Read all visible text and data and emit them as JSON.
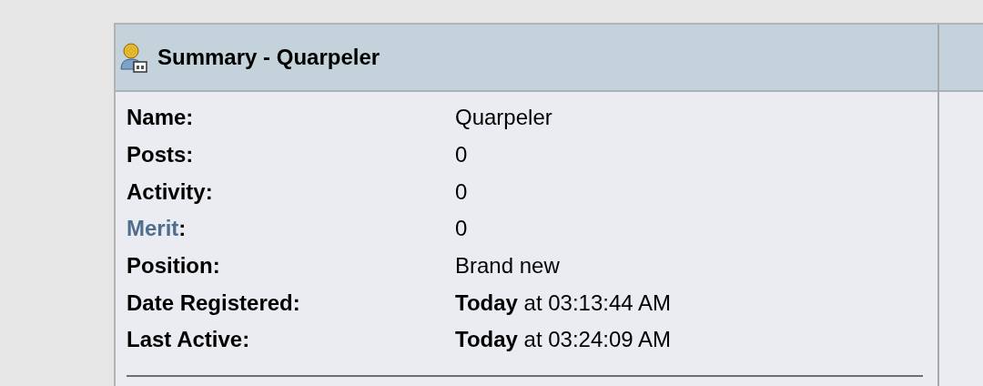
{
  "panel": {
    "title": "Summary - Quarpeler"
  },
  "rows": [
    {
      "kind": "text",
      "label": "Name:",
      "value": "Quarpeler"
    },
    {
      "kind": "text",
      "label": "Posts:",
      "value": "0"
    },
    {
      "kind": "text",
      "label": "Activity:",
      "value": "0"
    },
    {
      "kind": "link",
      "label": "Merit",
      "suffix": ":",
      "value": "0"
    },
    {
      "kind": "text",
      "label": "Position:",
      "value": "Brand new"
    },
    {
      "kind": "text",
      "label": "Date Registered:",
      "value": "**Today** at 03:13:44 AM"
    },
    {
      "kind": "text",
      "label": "Last Active:",
      "value": "**Today** at 03:24:09 AM"
    }
  ]
}
